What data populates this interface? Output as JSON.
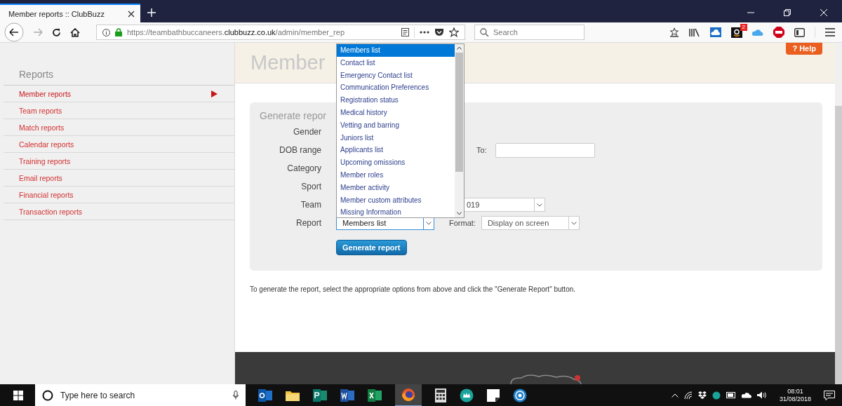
{
  "browser": {
    "tab_title": "Member reports :: ClubBuzz",
    "url_prefix": "https://teambathbuccaneers.",
    "url_domain": "clubbuzz.co.uk",
    "url_path": "/admin/member_rep",
    "search_placeholder": "Search",
    "badge": "2"
  },
  "sidebar": {
    "heading": "Reports",
    "items": [
      {
        "label": "Member reports",
        "selected": true
      },
      {
        "label": "Team reports",
        "selected": false
      },
      {
        "label": "Match reports",
        "selected": false
      },
      {
        "label": "Calendar reports",
        "selected": false
      },
      {
        "label": "Training reports",
        "selected": false
      },
      {
        "label": "Email reports",
        "selected": false
      },
      {
        "label": "Financial reports",
        "selected": false
      },
      {
        "label": "Transaction reports",
        "selected": false
      }
    ]
  },
  "page": {
    "title": "Member",
    "help": "? Help"
  },
  "form": {
    "title": "Generate repor",
    "labels": [
      "Gender",
      "DOB range",
      "Category",
      "Sport",
      "Team",
      "Report"
    ],
    "to_label": "To:",
    "team_value": "019",
    "report_value": "Members list",
    "format_label": "Format:",
    "format_value": "Display on screen",
    "button": "Generate report"
  },
  "dropdown": {
    "options": [
      {
        "label": "Members list",
        "selected": true
      },
      {
        "label": "Contact list",
        "selected": false
      },
      {
        "label": "Emergency Contact list",
        "selected": false
      },
      {
        "label": "Communication Preferences",
        "selected": false
      },
      {
        "label": "Registration status",
        "selected": false
      },
      {
        "label": "Medical history",
        "selected": false
      },
      {
        "label": "Vetting and barring",
        "selected": false
      },
      {
        "label": "Juniors list",
        "selected": false
      },
      {
        "label": "Applicants list",
        "selected": false
      },
      {
        "label": "Upcoming omissions",
        "selected": false
      },
      {
        "label": "Member roles",
        "selected": false
      },
      {
        "label": "Member activity",
        "selected": false
      },
      {
        "label": "Member custom attributes",
        "selected": false
      },
      {
        "label": "Missing Information",
        "selected": false
      }
    ]
  },
  "instructions": "To generate the report, select the appropriate options from above and click the \"Generate Report\" button.",
  "taskbar": {
    "search_placeholder": "Type here to search",
    "time": "08:01",
    "date": "31/08/2018"
  }
}
